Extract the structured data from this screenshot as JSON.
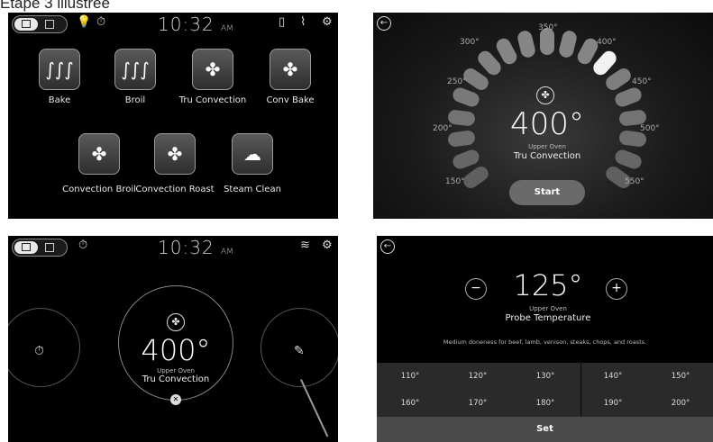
{
  "caption": "Etape 3 illustree",
  "panel1": {
    "clock_time": "10:32",
    "clock_ampm": "AM",
    "modes": [
      {
        "label": "Bake",
        "icon": "bake-heat-icon"
      },
      {
        "label": "Broil",
        "icon": "broil-heat-icon"
      },
      {
        "label": "Tru Convection",
        "icon": "fan-icon"
      },
      {
        "label": "Conv Bake",
        "icon": "fan-bake-icon"
      },
      {
        "label": "Convection Broil",
        "icon": "fan-broil-icon"
      },
      {
        "label": "Convection Roast",
        "icon": "fan-roast-icon"
      },
      {
        "label": "Steam Clean",
        "icon": "steam-clean-icon"
      }
    ]
  },
  "panel2": {
    "temp_labels": [
      "150°",
      "200°",
      "250°",
      "300°",
      "350°",
      "400°",
      "450°",
      "500°",
      "550°"
    ],
    "temperature": "400°",
    "oven": "Upper Oven",
    "mode": "Tru Convection",
    "start_label": "Start",
    "selected_temp": "400°"
  },
  "panel3": {
    "clock_time": "10:32",
    "clock_ampm": "AM",
    "temperature": "400°",
    "oven": "Upper Oven",
    "mode": "Tru Convection"
  },
  "panel4": {
    "temperature": "125°",
    "oven": "Upper Oven",
    "title": "Probe Temperature",
    "note": "Medium doneness for beef, lamb, venison, steaks, chops, and roasts.",
    "options": [
      "110°",
      "120°",
      "130°",
      "140°",
      "150°",
      "160°",
      "170°",
      "180°",
      "190°",
      "200°"
    ],
    "set_label": "Set",
    "minus_label": "−",
    "plus_label": "+"
  }
}
